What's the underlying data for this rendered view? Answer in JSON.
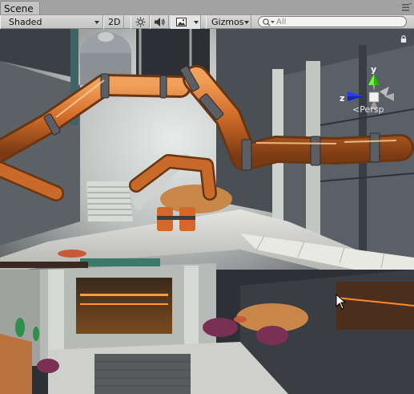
{
  "tab": {
    "title": "Scene"
  },
  "toolbar": {
    "shading_mode": "Shaded",
    "mode_2d": "2D",
    "gizmos": "Gizmos",
    "search_placeholder": "All"
  },
  "gizmo": {
    "y_label": "y",
    "z_label": "z",
    "projection": "Persp"
  }
}
